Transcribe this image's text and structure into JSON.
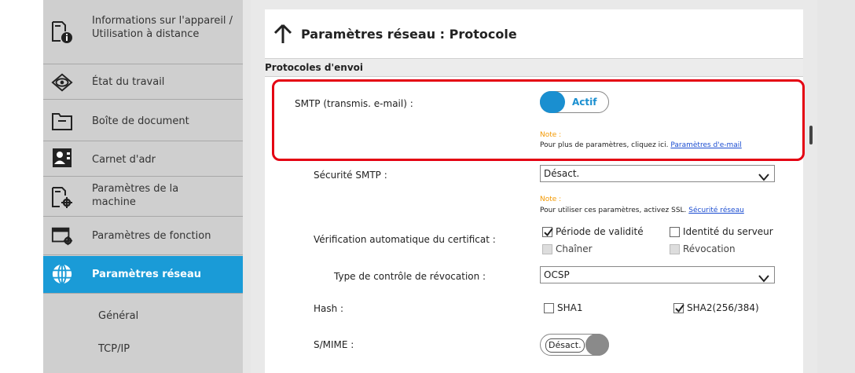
{
  "sidebar": {
    "items": [
      {
        "label": "Informations sur l'appareil / Utilisation à distance",
        "icon": "device-info-icon"
      },
      {
        "label": "État du travail",
        "icon": "eye-icon"
      },
      {
        "label": "Boîte de document",
        "icon": "folder-icon"
      },
      {
        "label": "Carnet d'adr",
        "icon": "address-book-icon"
      },
      {
        "label": "Paramètres de la machine",
        "icon": "machine-settings-icon"
      },
      {
        "label": "Paramètres de fonction",
        "icon": "function-settings-icon"
      },
      {
        "label": "Paramètres réseau",
        "icon": "globe-icon",
        "active": true
      }
    ],
    "subitems": [
      {
        "label": "Général"
      },
      {
        "label": "TCP/IP"
      }
    ]
  },
  "main": {
    "title": "Paramètres réseau : Protocole",
    "section": "Protocoles d'envoi",
    "smtp": {
      "label": "SMTP (transmis. e-mail) :",
      "toggle": "Actif",
      "note_heading": "Note :",
      "note_text": "Pour plus de paramètres, cliquez ici.",
      "note_link": "Paramètres d'e-mail"
    },
    "smtp_security": {
      "label": "Sécurité SMTP :",
      "value": "Désact.",
      "note_heading": "Note :",
      "note_text": "Pour utiliser ces paramètres, activez SSL.",
      "note_link": "Sécurité réseau"
    },
    "cert_check": {
      "label": "Vérification automatique du certificat :",
      "options": [
        {
          "label": "Période de validité",
          "checked": true,
          "disabled": false
        },
        {
          "label": "Identité du serveur",
          "checked": false,
          "disabled": false
        },
        {
          "label": "Chaîner",
          "checked": false,
          "disabled": true
        },
        {
          "label": "Révocation",
          "checked": false,
          "disabled": true
        }
      ]
    },
    "revocation_type": {
      "label": "Type de contrôle de révocation :",
      "value": "OCSP"
    },
    "hash": {
      "label": "Hash :",
      "options": [
        {
          "label": "SHA1",
          "checked": false
        },
        {
          "label": "SHA2(256/384)",
          "checked": true
        }
      ]
    },
    "smime": {
      "label": "S/MIME :",
      "toggle": "Désact."
    }
  },
  "colors": {
    "accent": "#1a9bd7",
    "highlight": "#e40012",
    "note": "#f39800",
    "link": "#1a4cd1"
  }
}
